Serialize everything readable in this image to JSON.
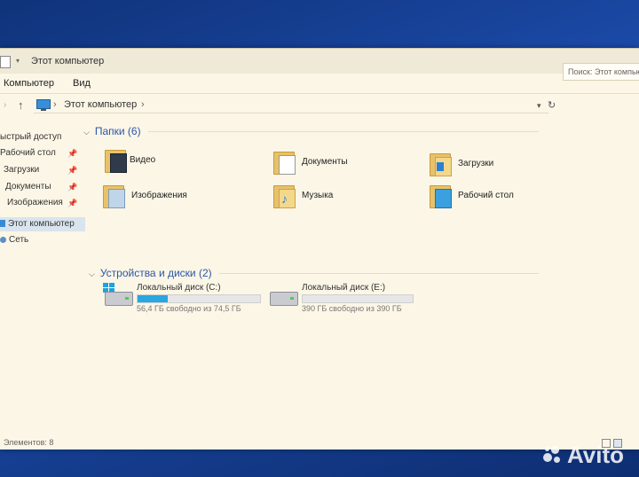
{
  "window": {
    "title": "Этот компьютер",
    "menu": {
      "computer": "Компьютер",
      "view": "Вид"
    }
  },
  "address": {
    "crumb": "Этот компьютер",
    "separator": "›",
    "search_placeholder": "Поиск: Этот компьютер"
  },
  "sidebar": {
    "items": [
      {
        "label": "ыстрый доступ",
        "pinned": false
      },
      {
        "label": "Рабочий стол",
        "pinned": true
      },
      {
        "label": "Загрузки",
        "pinned": true
      },
      {
        "label": "Документы",
        "pinned": true
      },
      {
        "label": "Изображения",
        "pinned": true
      },
      {
        "label": "Этот компьютер",
        "selected": true
      },
      {
        "label": "Сеть"
      }
    ],
    "pin_glyph": "📌"
  },
  "folders_group": {
    "title": "Папки (6)",
    "items": [
      {
        "label": "Видео",
        "icon": "video-folder-icon"
      },
      {
        "label": "Документы",
        "icon": "documents-folder-icon"
      },
      {
        "label": "Загрузки",
        "icon": "downloads-folder-icon"
      },
      {
        "label": "Изображения",
        "icon": "pictures-folder-icon"
      },
      {
        "label": "Музыка",
        "icon": "music-folder-icon"
      },
      {
        "label": "Рабочий стол",
        "icon": "desktop-folder-icon"
      }
    ]
  },
  "drives_group": {
    "title": "Устройства и диски (2)",
    "items": [
      {
        "label": "Локальный диск (C:)",
        "free_text": "56,4 ГБ свободно из 74,5 ГБ",
        "used_fraction": 0.243,
        "system": true
      },
      {
        "label": "Локальный диск (E:)",
        "free_text": "390 ГБ свободно из 390 ГБ",
        "used_fraction": 0.0,
        "system": false
      }
    ]
  },
  "status": {
    "items_count": "Элементов: 8"
  },
  "watermark": {
    "text": "Avito"
  },
  "colors": {
    "accent": "#2b56a8",
    "drive_fill": "#2aa6e0",
    "window_bg": "#fbf6e6"
  }
}
